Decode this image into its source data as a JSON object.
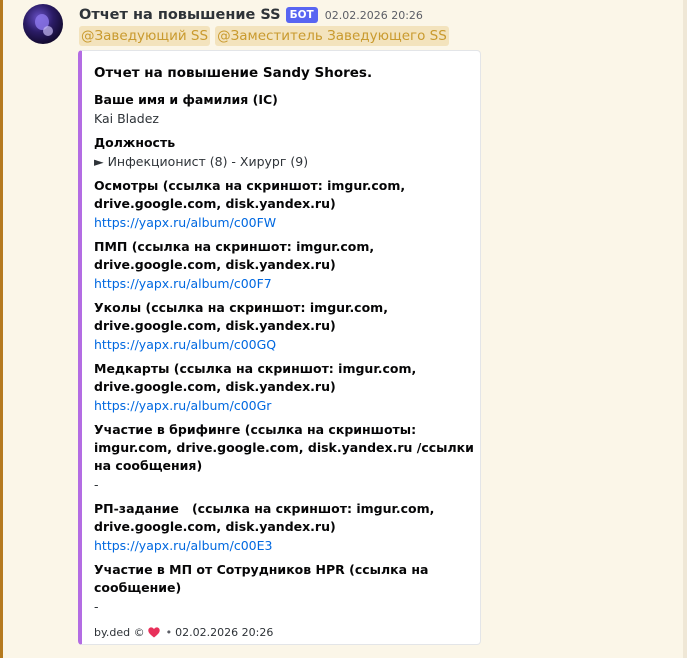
{
  "message": {
    "username": "Отчет на повышение SS",
    "badge": "БОТ",
    "timestamp": "02.02.2026 20:26",
    "mentions": [
      "@Заведующий SS",
      "@Заместитель Заведующего SS"
    ]
  },
  "embed": {
    "accent_color": "#b36ce3",
    "title": "Отчет на повышение Sandy Shores.",
    "fields": [
      {
        "name": "Ваше имя и фамилия (IC)",
        "value": "Kai Bladez",
        "is_link": false
      },
      {
        "name": "Должность",
        "value": "► Инфекционист (8) - Хирург (9)",
        "is_link": false
      },
      {
        "name": "Осмотры (ссылка на скриншот: imgur.com, drive.google.com, disk.yandex.ru)",
        "value": "https://yapx.ru/album/c00FW",
        "is_link": true
      },
      {
        "name": "ПМП (ссылка на скриншот: imgur.com, drive.google.com, disk.yandex.ru)",
        "value": "https://yapx.ru/album/c00F7",
        "is_link": true
      },
      {
        "name": "Уколы (ссылка на скриншот: imgur.com, drive.google.com, disk.yandex.ru)",
        "value": "https://yapx.ru/album/c00GQ",
        "is_link": true
      },
      {
        "name": "Медкарты (ссылка на скриншот: imgur.com, drive.google.com, disk.yandex.ru)",
        "value": "https://yapx.ru/album/c00Gr",
        "is_link": true
      },
      {
        "name": "Участие в брифинге (ссылка на скриншоты: imgur.com, drive.google.com, disk.yandex.ru /ссылки на сообщения)",
        "value": "-",
        "is_link": false
      },
      {
        "name": "РП-задание   (ссылка на скриншот: imgur.com, drive.google.com, disk.yandex.ru)",
        "value": "https://yapx.ru/album/c00E3",
        "is_link": true
      },
      {
        "name": "Участие в МП от Сотрудников HPR (ссылка на сообщение)",
        "value": "-",
        "is_link": false
      }
    ],
    "footer": {
      "text": "by.ded ©",
      "separator": "•",
      "timestamp": "02.02.2026 20:26",
      "icon": "heart-icon",
      "heart_color": "#e8305a"
    }
  }
}
